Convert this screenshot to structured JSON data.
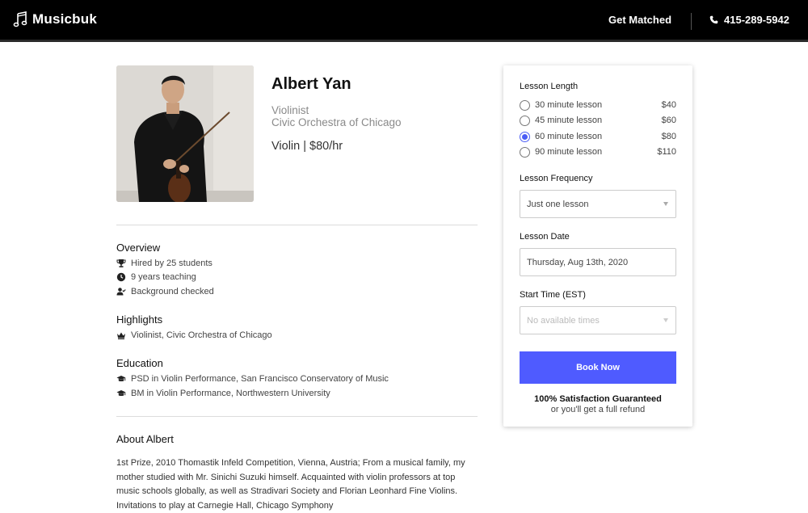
{
  "header": {
    "brand": "Musicbuk",
    "nav_link": "Get Matched",
    "phone": "415-289-5942",
    "brand_icon": "music-note-icon",
    "phone_icon": "phone-icon"
  },
  "profile": {
    "name": "Albert Yan",
    "role_line1": "Violinist",
    "role_line2": "Civic Orchestra of Chicago",
    "instrument_rate": "Violin | $80/hr"
  },
  "overview": {
    "title": "Overview",
    "items": [
      {
        "icon": "trophy-icon",
        "text": "Hired by 25 students"
      },
      {
        "icon": "clock-icon",
        "text": "9 years teaching"
      },
      {
        "icon": "user-check-icon",
        "text": "Background checked"
      }
    ]
  },
  "highlights": {
    "title": "Highlights",
    "items": [
      {
        "icon": "crown-icon",
        "text": "Violinist, Civic Orchestra of Chicago"
      }
    ]
  },
  "education": {
    "title": "Education",
    "items": [
      {
        "icon": "graduation-cap-icon",
        "text": "PSD in Violin Performance, San Francisco Conservatory of Music"
      },
      {
        "icon": "graduation-cap-icon",
        "text": "BM in Violin Performance, Northwestern University"
      }
    ]
  },
  "about": {
    "title": "About Albert",
    "text": "1st Prize, 2010 Thomastik Infeld Competition, Vienna, Austria; From a musical family, my mother studied with Mr. Sinichi Suzuki himself. Acquainted with violin professors at top music schools globally, as well as Stradivari Society and Florian Leonhard Fine Violins. Invitations to play at Carnegie Hall, Chicago Symphony"
  },
  "booking": {
    "lesson_length_label": "Lesson Length",
    "options": [
      {
        "label": "30 minute lesson",
        "price": "$40",
        "selected": false
      },
      {
        "label": "45 minute lesson",
        "price": "$60",
        "selected": false
      },
      {
        "label": "60 minute lesson",
        "price": "$80",
        "selected": true
      },
      {
        "label": "90 minute lesson",
        "price": "$110",
        "selected": false
      }
    ],
    "frequency_label": "Lesson Frequency",
    "frequency_value": "Just one lesson",
    "date_label": "Lesson Date",
    "date_value": "Thursday, Aug 13th, 2020",
    "time_label": "Start Time (EST)",
    "time_placeholder": "No available times",
    "book_button": "Book Now",
    "guarantee": "100% Satisfaction Guaranteed",
    "refund": "or you'll get a full refund",
    "accent_color": "#4f5bff"
  }
}
